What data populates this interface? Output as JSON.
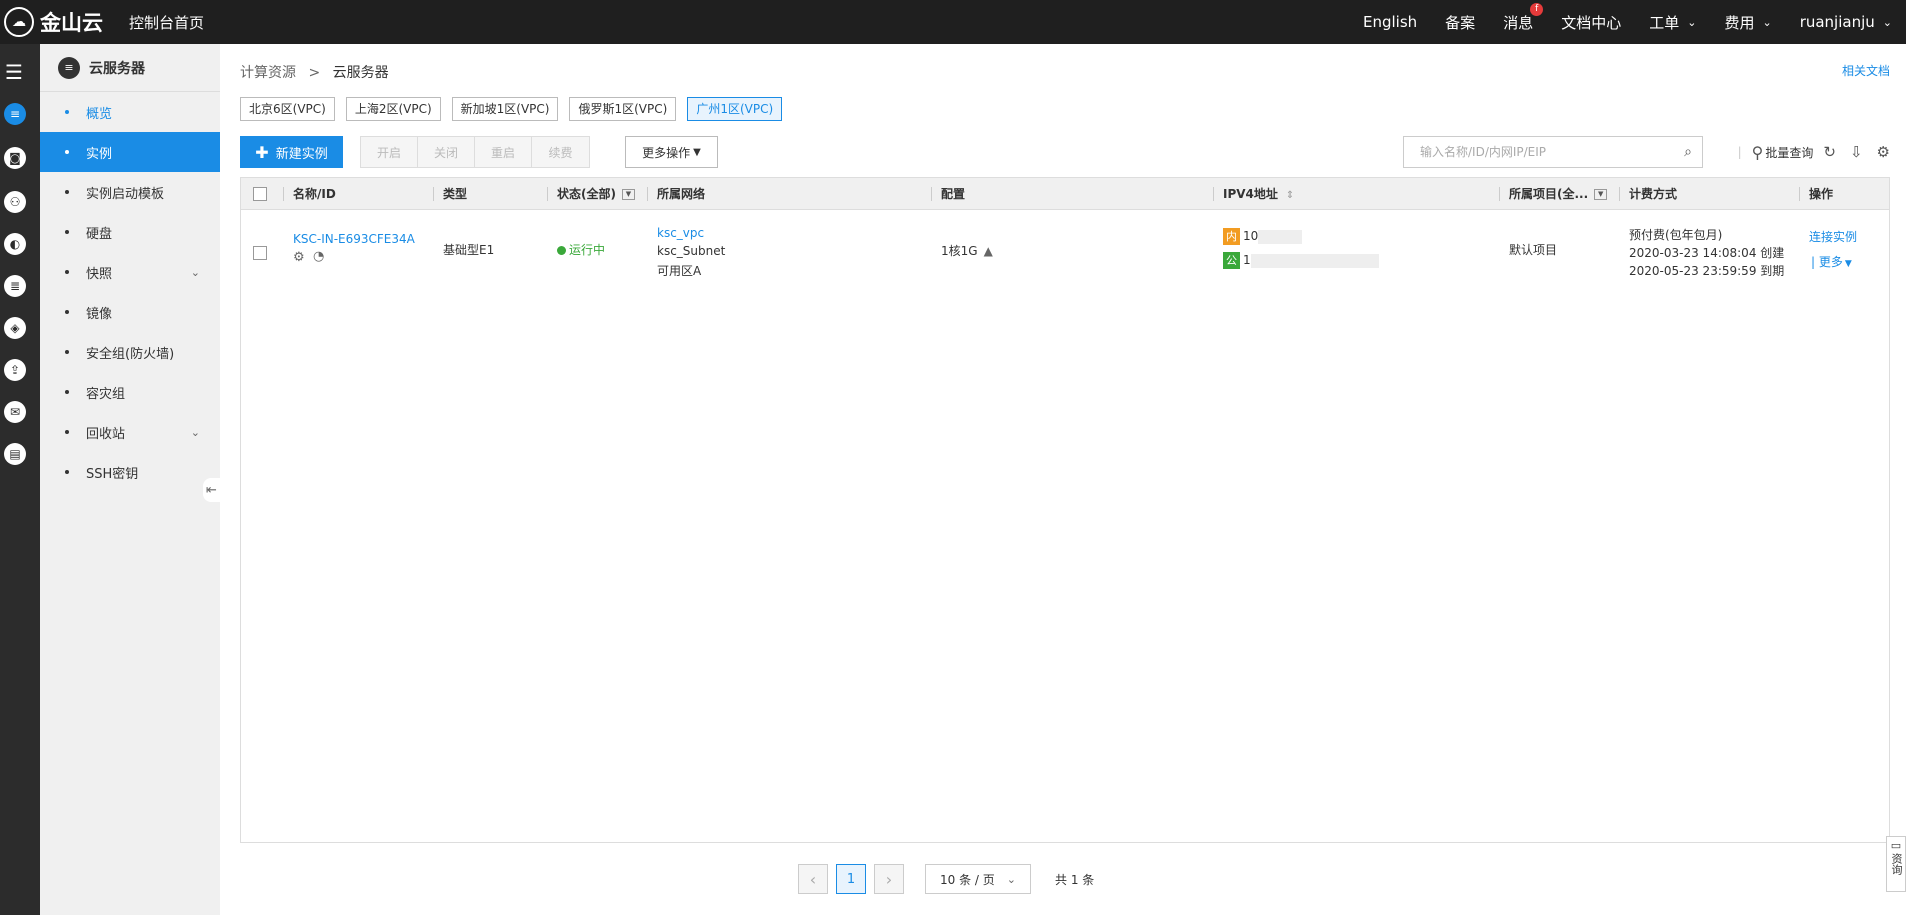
{
  "topbar": {
    "logo_text": "金山云",
    "home": "控制台首页",
    "items": [
      {
        "label": "English",
        "chev": false
      },
      {
        "label": "备案",
        "chev": false
      },
      {
        "label": "消息",
        "chev": false,
        "badge": "f"
      },
      {
        "label": "文档中心",
        "chev": false
      },
      {
        "label": "工单",
        "chev": true
      },
      {
        "label": "费用",
        "chev": true
      },
      {
        "label": "ruanjianju",
        "chev": true
      }
    ]
  },
  "sidebar": {
    "title": "云服务器",
    "items": [
      {
        "label": "概览",
        "state": "blue",
        "expand": false
      },
      {
        "label": "实例",
        "state": "active",
        "expand": false
      },
      {
        "label": "实例启动模板",
        "state": "",
        "expand": false
      },
      {
        "label": "硬盘",
        "state": "",
        "expand": false
      },
      {
        "label": "快照",
        "state": "",
        "expand": true
      },
      {
        "label": "镜像",
        "state": "",
        "expand": false
      },
      {
        "label": "安全组(防火墙)",
        "state": "",
        "expand": false
      },
      {
        "label": "容灾组",
        "state": "",
        "expand": false
      },
      {
        "label": "回收站",
        "state": "",
        "expand": true
      },
      {
        "label": "SSH密钥",
        "state": "",
        "expand": false
      }
    ]
  },
  "breadcrumb": {
    "parent": "计算资源",
    "sep": ">",
    "current": "云服务器"
  },
  "doc_link": "相关文档",
  "regions": [
    {
      "label": "北京6区(VPC)",
      "active": false
    },
    {
      "label": "上海2区(VPC)",
      "active": false
    },
    {
      "label": "新加坡1区(VPC)",
      "active": false
    },
    {
      "label": "俄罗斯1区(VPC)",
      "active": false
    },
    {
      "label": "广州1区(VPC)",
      "active": true
    }
  ],
  "toolbar": {
    "new_instance": "新建实例",
    "disabled_buttons": [
      "开启",
      "关闭",
      "重启",
      "续费"
    ],
    "more_ops": "更多操作",
    "search_placeholder": "输入名称/ID/内网IP/EIP",
    "batch_query": "批量查询"
  },
  "table": {
    "headers": {
      "name": "名称/ID",
      "type": "类型",
      "status": "状态(全部)",
      "network": "所属网络",
      "config": "配置",
      "ipv4": "IPV4地址",
      "project": "所属项目(全...",
      "billing": "计费方式",
      "ops": "操作"
    },
    "row": {
      "id": "KSC-IN-E693CFE34A",
      "type": "基础型E1",
      "status": "运行中",
      "vpc": "ksc_vpc",
      "subnet": "ksc_Subnet",
      "zone": "可用区A",
      "config": "1核1G",
      "ip_in_tag": "内",
      "ip_in": "10",
      "ip_pub_tag": "公",
      "ip_pub": "1",
      "project": "默认项目",
      "billing_type": "预付费(包年包月)",
      "created": "2020-03-23 14:08:04 创建",
      "expires": "2020-05-23 23:59:59 到期",
      "op_connect": "连接实例",
      "op_more": "| 更多"
    }
  },
  "pager": {
    "current": "1",
    "page_size": "10 条 / 页",
    "total": "共 1 条"
  },
  "consult": "资询"
}
